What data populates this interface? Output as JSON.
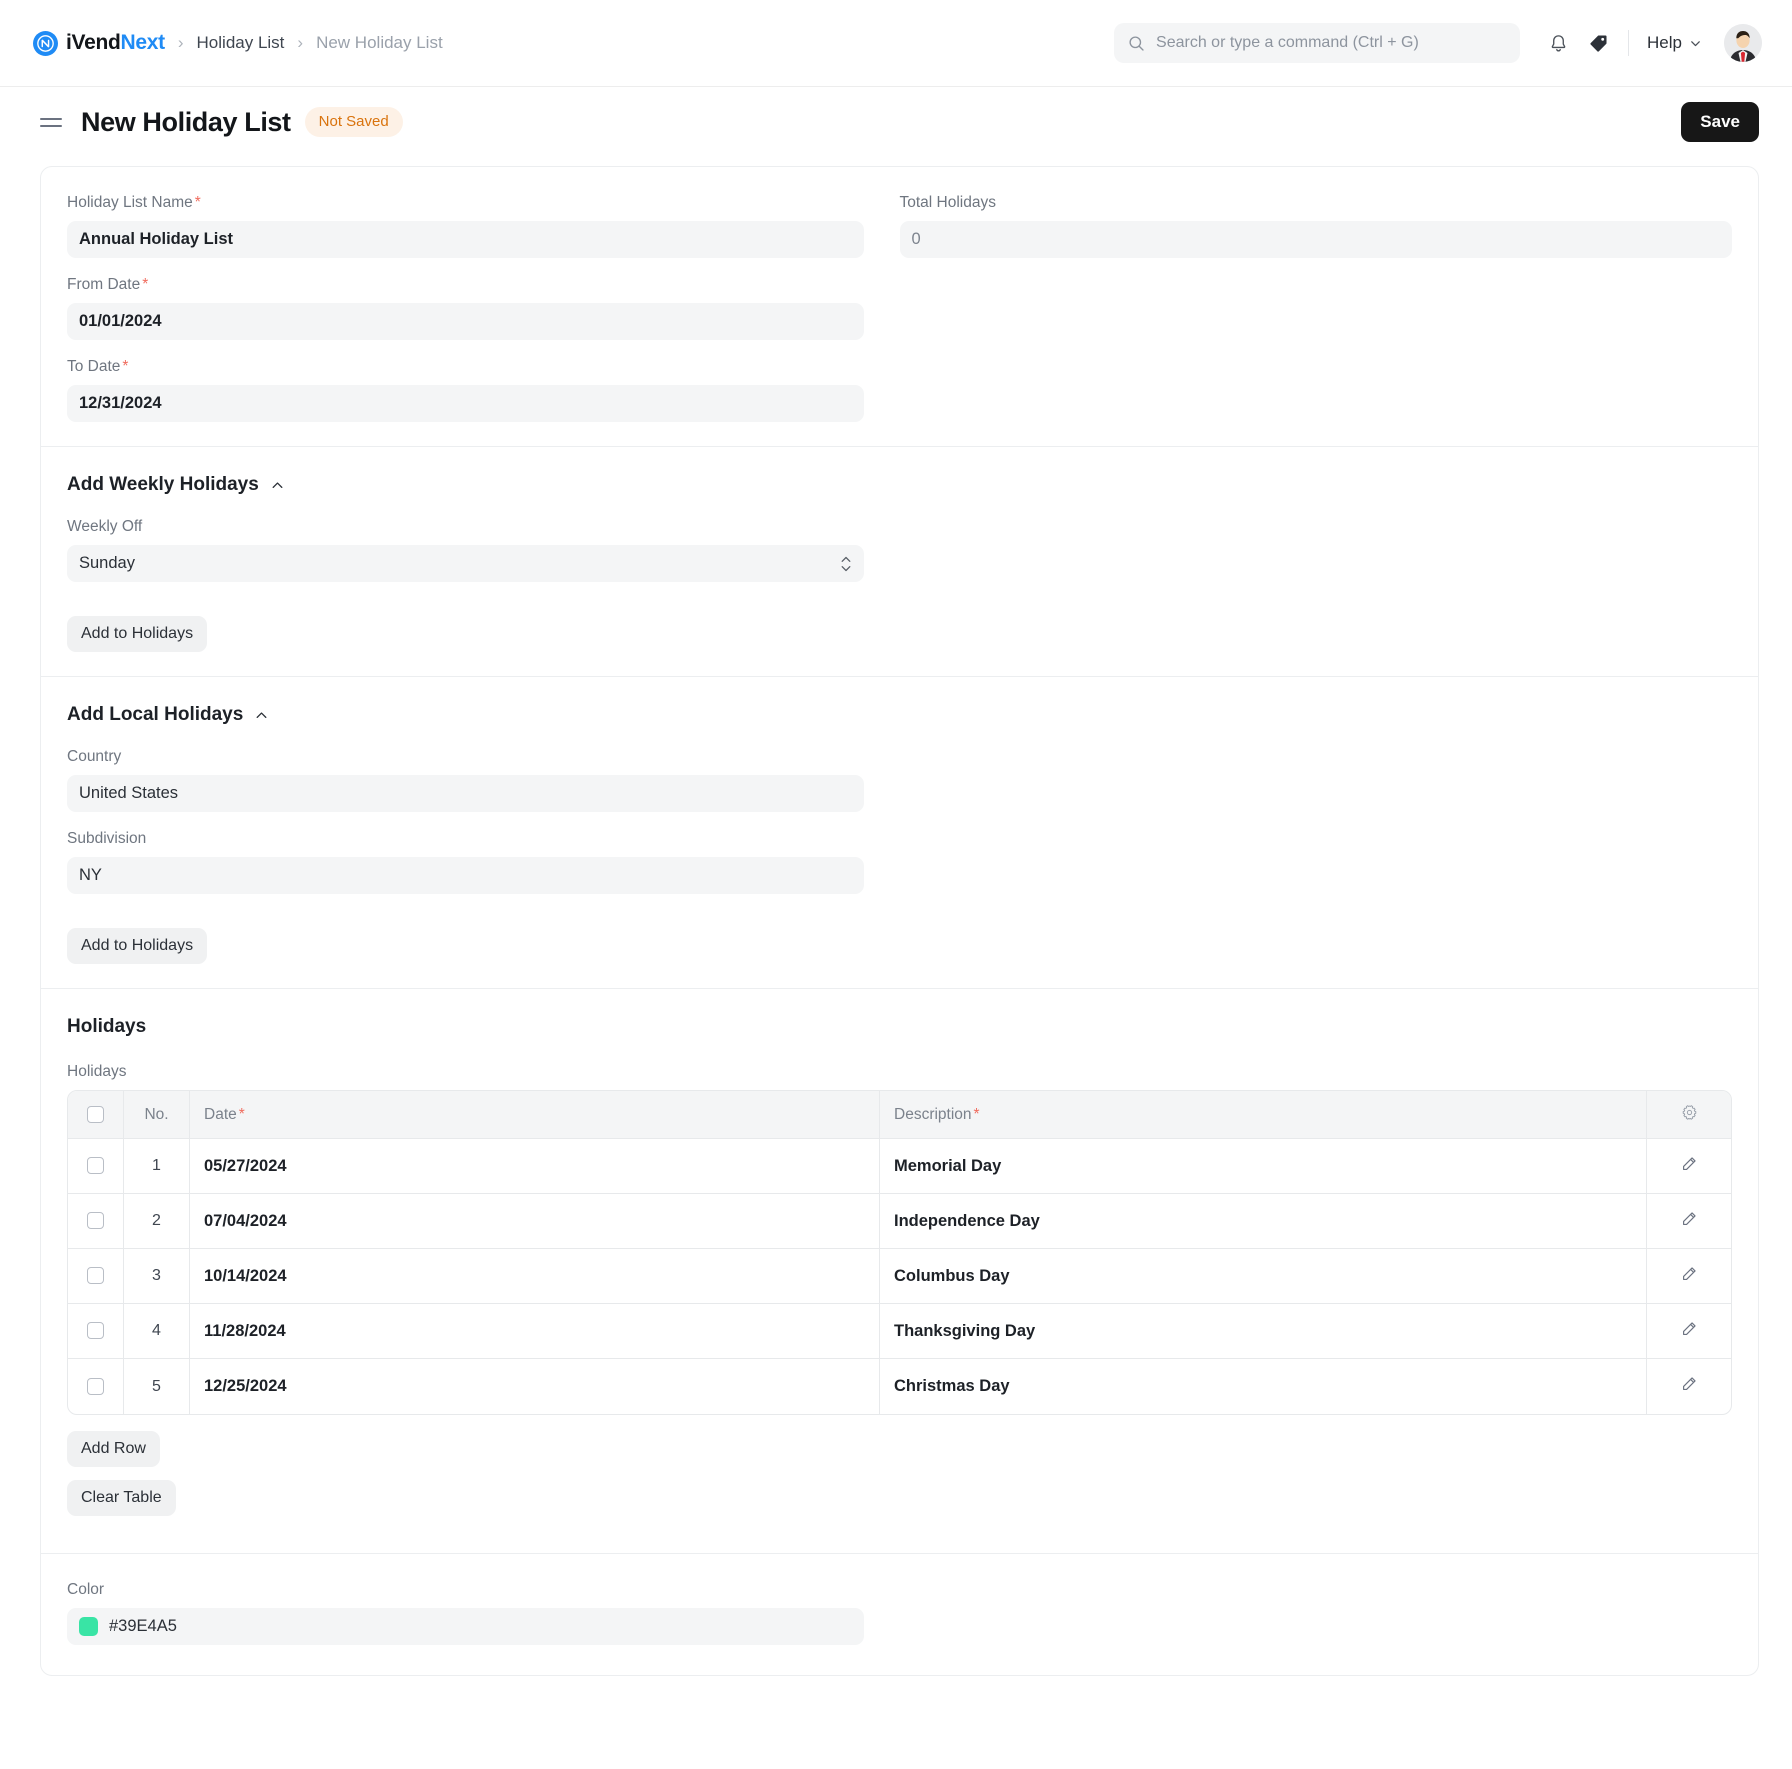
{
  "navbar": {
    "brand": {
      "prefix": "iVend",
      "accent": "Next",
      "logo_icon": "ivendnext-logo-icon"
    },
    "breadcrumb": [
      {
        "label": "Holiday List",
        "muted": false
      },
      {
        "label": "New Holiday List",
        "muted": true
      }
    ],
    "search": {
      "placeholder": "Search or type a command (Ctrl + G)",
      "value": "",
      "icon": "search-icon"
    },
    "notifications_icon": "bell-icon",
    "tag_icon": "tag-icon",
    "help": {
      "label": "Help",
      "icon": "chevron-down-icon"
    },
    "avatar_icon": "user-avatar"
  },
  "pagehead": {
    "menu_icon": "hamburger-menu-icon",
    "title": "New Holiday List",
    "status_badge": "Not Saved",
    "save_label": "Save"
  },
  "form": {
    "holiday_list_name": {
      "label": "Holiday List Name",
      "required": true,
      "value": "Annual Holiday List"
    },
    "total_holidays": {
      "label": "Total Holidays",
      "required": false,
      "value": "0"
    },
    "from_date": {
      "label": "From Date",
      "required": true,
      "value": "01/01/2024"
    },
    "to_date": {
      "label": "To Date",
      "required": true,
      "value": "12/31/2024"
    }
  },
  "weekly_section": {
    "title": "Add Weekly Holidays",
    "collapse_icon": "chevron-up-icon",
    "weekly_off": {
      "label": "Weekly Off",
      "value": "Sunday",
      "dropdown_icon": "select-caret-icon"
    },
    "add_button": "Add to Holidays"
  },
  "local_section": {
    "title": "Add Local Holidays",
    "collapse_icon": "chevron-up-icon",
    "country": {
      "label": "Country",
      "value": "United States"
    },
    "subdivision": {
      "label": "Subdivision",
      "value": "NY"
    },
    "add_button": "Add to Holidays"
  },
  "holidays_section": {
    "title": "Holidays",
    "grid_label": "Holidays",
    "columns": [
      {
        "label": "",
        "key": "check"
      },
      {
        "label": "No.",
        "key": "no"
      },
      {
        "label": "Date",
        "key": "date",
        "required": true
      },
      {
        "label": "Description",
        "key": "description",
        "required": true
      },
      {
        "label": "",
        "key": "settings",
        "icon": "gear-icon"
      }
    ],
    "rows": [
      {
        "no": "1",
        "date": "05/27/2024",
        "description": "Memorial Day",
        "edit_icon": "pencil-icon",
        "checked": false
      },
      {
        "no": "2",
        "date": "07/04/2024",
        "description": "Independence Day",
        "edit_icon": "pencil-icon",
        "checked": false
      },
      {
        "no": "3",
        "date": "10/14/2024",
        "description": "Columbus Day",
        "edit_icon": "pencil-icon",
        "checked": false
      },
      {
        "no": "4",
        "date": "11/28/2024",
        "description": "Thanksgiving Day",
        "edit_icon": "pencil-icon",
        "checked": false
      },
      {
        "no": "5",
        "date": "12/25/2024",
        "description": "Christmas Day",
        "edit_icon": "pencil-icon",
        "checked": false
      }
    ],
    "add_row_label": "Add Row",
    "clear_table_label": "Clear Table"
  },
  "color_section": {
    "label": "Color",
    "value": "#39E4A5",
    "swatch_hex": "#39E4A5"
  },
  "theme": {
    "brand_blue": "#1f8bf5",
    "badge_bg": "#fdf1e6",
    "badge_fg": "#d9730d",
    "save_bg": "#171717",
    "input_bg": "#f4f5f6",
    "required_red": "#f06b5d"
  }
}
